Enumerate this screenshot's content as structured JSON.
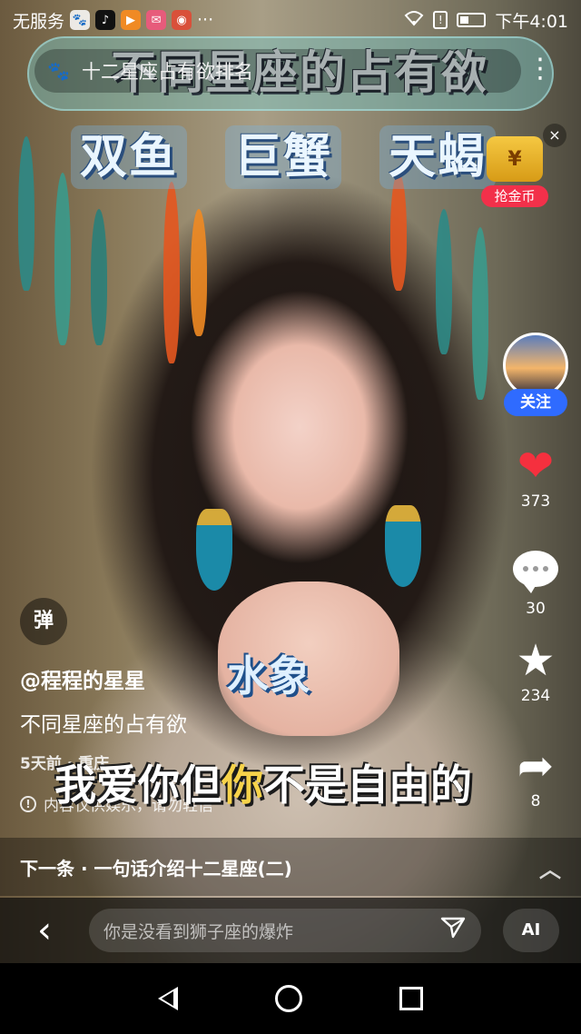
{
  "status_bar": {
    "carrier": "无服务",
    "app_icons": [
      "paw-icon",
      "tiktok-icon",
      "video-icon",
      "chat-icon",
      "game-icon"
    ],
    "more": "···",
    "time": "下午4:01"
  },
  "top_overlay": {
    "big_title": "不同星座的占有欲",
    "mini_title": "十二星座占有欲排名",
    "signs": [
      "双鱼",
      "巨蟹",
      "天蝎"
    ],
    "more_icon": "⋮",
    "coin_label": "抢金币",
    "close": "×"
  },
  "actions": {
    "follow": "关注",
    "like_count": "373",
    "comment_count": "30",
    "favorite_count": "234",
    "share_count": "8"
  },
  "danmu": "弹",
  "captions": {
    "water": "水象",
    "sub_pre": "我爱你但",
    "sub_highlight": "你",
    "sub_post": "不是自由的"
  },
  "info": {
    "author": "@程程的星星",
    "description": "不同星座的占有欲",
    "meta": "5天前 · 重庆",
    "notice": "内容仅供娱乐，请勿轻信"
  },
  "next": {
    "text": "下一条 · 一句话介绍十二星座(二)"
  },
  "input": {
    "placeholder": "你是没看到狮子座的爆炸",
    "ai": "AI"
  },
  "colors": {
    "like": "#f5303e",
    "follow": "#2f6bff",
    "coin_badge": "#f2304a"
  }
}
